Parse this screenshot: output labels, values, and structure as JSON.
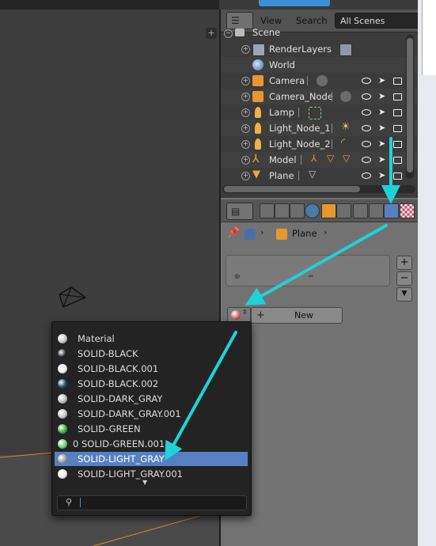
{
  "outliner": {
    "view_label": "View",
    "search_label": "Search",
    "scene_filter": "All Scenes",
    "scene_label": "Scene",
    "rows": [
      {
        "label": "RenderLayers",
        "icon": "render-layers-icon"
      },
      {
        "label": "World",
        "icon": "world-icon"
      },
      {
        "label": "Camera",
        "icon": "camera-object-icon"
      },
      {
        "label": "Camera_Node",
        "icon": "camera-object-icon"
      },
      {
        "label": "Lamp",
        "icon": "lamp-icon"
      },
      {
        "label": "Light_Node_1",
        "icon": "lamp-icon"
      },
      {
        "label": "Light_Node_2",
        "icon": "lamp-icon"
      },
      {
        "label": "Model",
        "icon": "armature-icon"
      },
      {
        "label": "Plane",
        "icon": "mesh-icon"
      }
    ]
  },
  "properties": {
    "context_object": "Plane",
    "new_button": "New",
    "add_slot": "+",
    "remove_slot": "−"
  },
  "material_dropdown": {
    "items": [
      {
        "label": "Material",
        "color": "#c8c8c8"
      },
      {
        "label": "SOLID-BLACK",
        "color": "#1e1e2a"
      },
      {
        "label": "SOLID-BLACK.001",
        "color": "#f0f0f0"
      },
      {
        "label": "SOLID-BLACK.002",
        "color": "#1f4a5a"
      },
      {
        "label": "SOLID-DARK_GRAY",
        "color": "#bdbdbd"
      },
      {
        "label": "SOLID-DARK_GRAY.001",
        "color": "#c9c9bf"
      },
      {
        "label": "SOLID-GREEN",
        "color": "#3cb043"
      },
      {
        "label": "0 SOLID-GREEN.001",
        "color": "#6ccf7a"
      },
      {
        "label": "SOLID-LIGHT_GRAY",
        "color": "#9a9a9a",
        "selected": true
      },
      {
        "label": "SOLID-LIGHT_GRAY.001",
        "color": "#ececec"
      }
    ],
    "search_value": ""
  },
  "colors": {
    "annotation_arrow": "#1ed2d8",
    "selection": "#5680c2"
  }
}
